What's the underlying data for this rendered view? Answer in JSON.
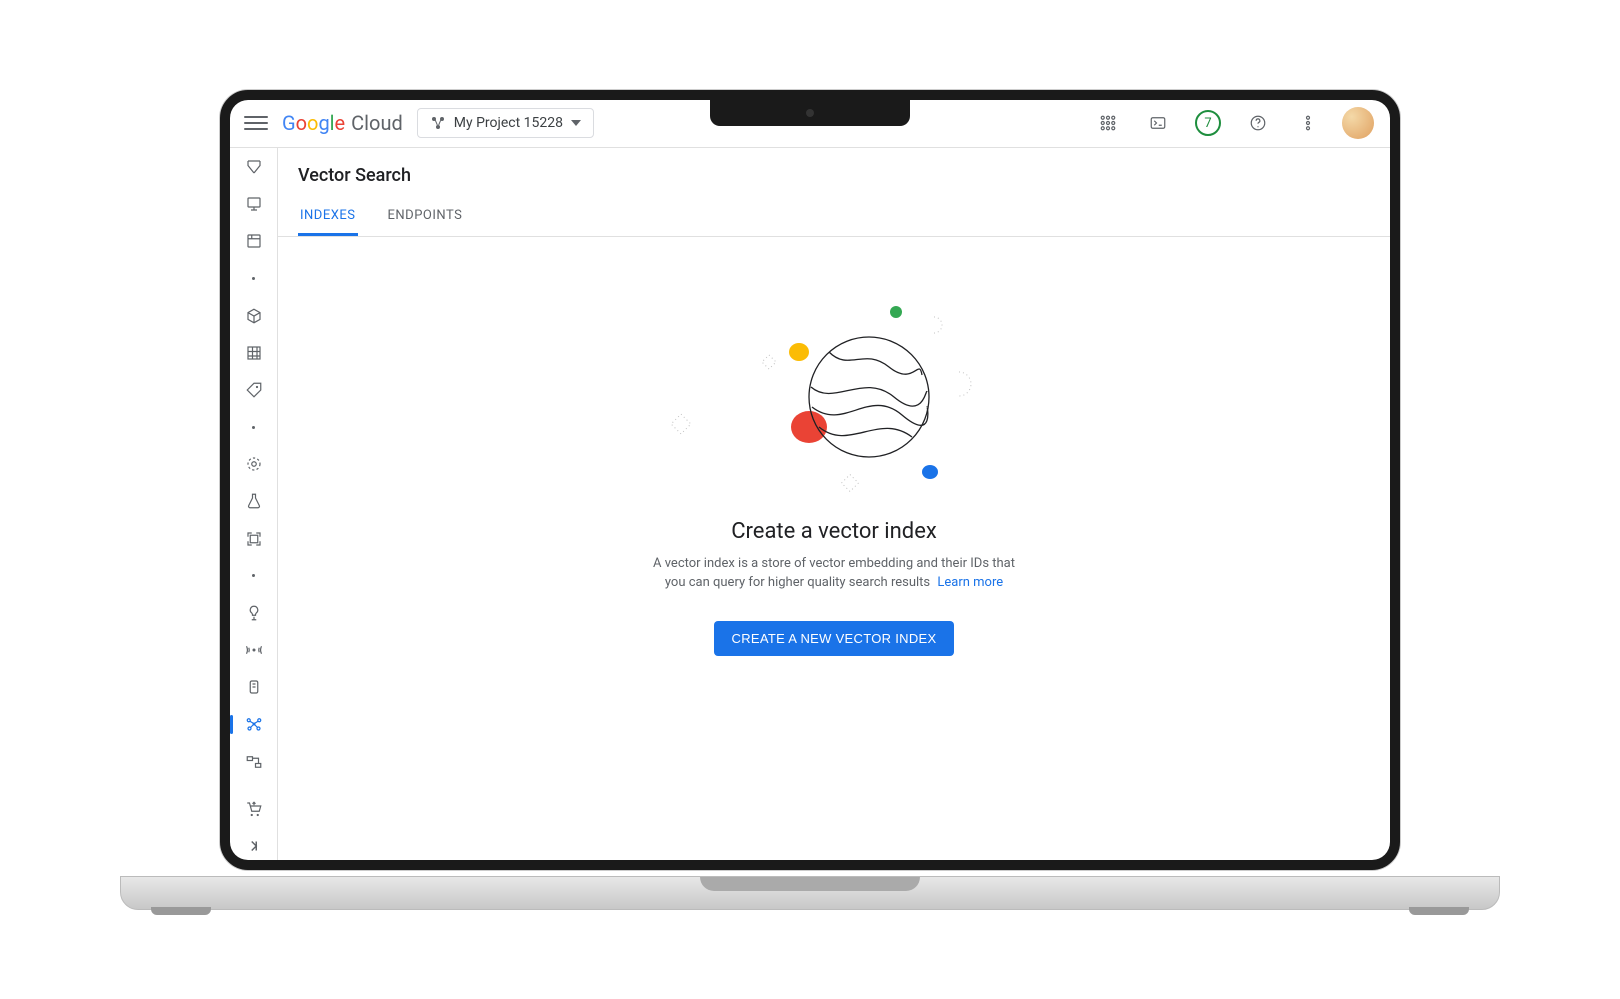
{
  "header": {
    "logo_brand": "Google",
    "logo_suffix": "Cloud",
    "project_name": "My Project 15228",
    "trial_badge": "7"
  },
  "page": {
    "title": "Vector Search"
  },
  "tabs": [
    {
      "id": "indexes",
      "label": "INDEXES",
      "active": true
    },
    {
      "id": "endpoints",
      "label": "ENDPOINTS",
      "active": false
    }
  ],
  "empty_state": {
    "title": "Create a vector index",
    "description": "A vector index is a store of vector embedding and their IDs that you can query for higher quality search results",
    "learn_more": "Learn more",
    "cta": "CREATE A NEW VECTOR INDEX"
  },
  "colors": {
    "primary": "#1a73e8",
    "green": "#34a853",
    "yellow": "#fbbc05",
    "red": "#ea4335"
  }
}
